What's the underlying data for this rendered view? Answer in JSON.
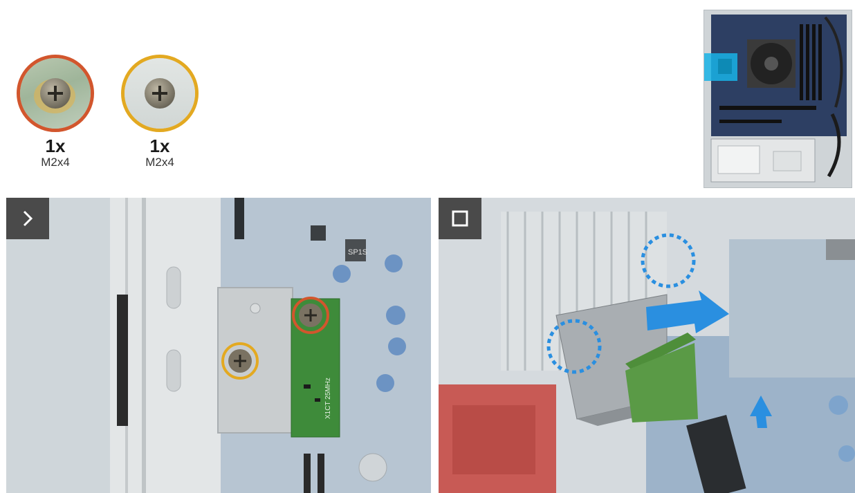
{
  "screws": [
    {
      "count": "1x",
      "size": "M2x4",
      "ring_color": "#d2562d"
    },
    {
      "count": "1x",
      "size": "M2x4",
      "ring_color": "#e3a921"
    }
  ],
  "colors": {
    "orange_ring": "#d2562d",
    "yellow_ring": "#e3a921",
    "callout_blue": "#2a8fe0",
    "arrow_blue": "#2a8fe0",
    "badge_gray": "#4a4a4a",
    "highlight_cyan": "#19b3e6"
  },
  "steps": [
    {
      "icon": "chevron-right-icon"
    },
    {
      "icon": "stop-square-icon"
    }
  ],
  "pcb_labels": {
    "inductor": "SP1S",
    "board_code": "X1CT 25MHz"
  }
}
